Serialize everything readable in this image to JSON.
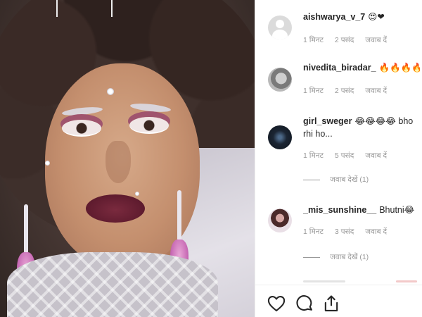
{
  "photo": {
    "subject": "portrait-photo"
  },
  "comments": [
    {
      "username": "aishwarya_v_7",
      "text": "😍❤",
      "time": "1 मिनट",
      "likes": "2 पसंद",
      "reply": "जवाब दें",
      "avatar": "default-avatar"
    },
    {
      "username": "nivedita_biradar_",
      "text": "🔥🔥🔥🔥",
      "time": "1 मिनट",
      "likes": "2 पसंद",
      "reply": "जवाब दें",
      "avatar": "gray-avatar"
    },
    {
      "username": "girl_sweger",
      "text": "😂😂😂😂 bho",
      "text_line2": "rhi ho...",
      "time": "1 मिनट",
      "likes": "5 पसंद",
      "reply": "जवाब दें",
      "view_replies": "जवाब देखें (1)",
      "avatar": "dark-avatar"
    },
    {
      "username": "_mis_sunshine__",
      "text": "Bhutni😂",
      "time": "1 मिनट",
      "likes": "3 पसंद",
      "reply": "जवाब दें",
      "view_replies": "जवाब देखें (1)",
      "avatar": "girl-avatar"
    }
  ],
  "actions": {
    "like": "heart-icon",
    "comment": "comment-icon",
    "share": "share-icon"
  },
  "colors": {
    "username": "#262626",
    "meta": "#999999",
    "border": "#efefef"
  }
}
